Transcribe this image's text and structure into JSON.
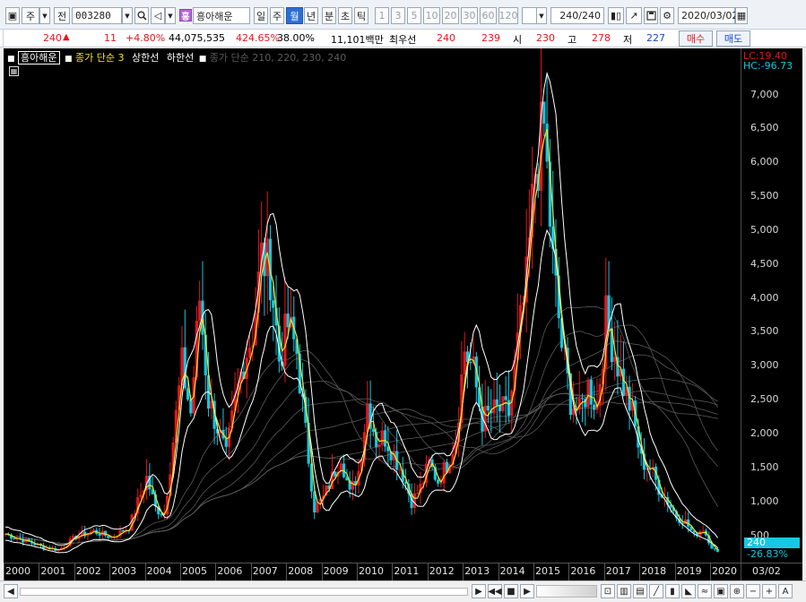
{
  "toolbar": {
    "market_label": "주",
    "prev_label": "전",
    "code": "003280",
    "stock_name": "흥아해운",
    "stock_badge": "흥",
    "periods": [
      "일",
      "주",
      "월",
      "년"
    ],
    "active_period": "월",
    "intraday": [
      "분",
      "초",
      "틱"
    ],
    "intervals": [
      "1",
      "3",
      "5",
      "10",
      "20",
      "30",
      "60",
      "120"
    ],
    "count": "240",
    "count_total": "/240",
    "date": "2020/03/02"
  },
  "quote": {
    "price": "240",
    "change": "11",
    "change_pct": "+4.80%",
    "volume": "44,075,535",
    "volume_ratio": "424.65%",
    "turnover": "38.00%",
    "amount": "11,101백만",
    "best_ask_label": "최우선",
    "best_ask": "240",
    "best_bid": "239",
    "open_label": "시",
    "open": "230",
    "high_label": "고",
    "high": "278",
    "low_label": "저",
    "low": "227",
    "buy_label": "매수",
    "sell_label": "매도"
  },
  "legend": {
    "name": "흥아해운",
    "ma": "종가 단순 3",
    "upper": "상한선",
    "lower": "하한선",
    "ma_multi": "종가 단순 210, 220, 230, 240"
  },
  "yaxis": {
    "lc": "LC:19.40",
    "hc": "HC:-96.73",
    "current": "240",
    "current_pct": "-26.83%"
  },
  "bottom": {
    "date_label": "03/02"
  },
  "colors": {
    "up": "#e5161e",
    "down": "#12c8e0",
    "ma": "#f2e12a",
    "band": "#ffffff",
    "thin": "#5a5a5a"
  },
  "chart_data": {
    "type": "candlestick",
    "x_ticks": [
      "2000",
      "2001",
      "2002",
      "2003",
      "2004",
      "2005",
      "2006",
      "2007",
      "2008",
      "2009",
      "2010",
      "2011",
      "2012",
      "2013",
      "2014",
      "2015",
      "2016",
      "2017",
      "2018",
      "2019",
      "2020"
    ],
    "y_ticks": [
      500,
      1000,
      1500,
      2000,
      2500,
      3000,
      3500,
      4000,
      4500,
      5000,
      5500,
      6000,
      6500,
      7000
    ],
    "ylim": [
      150,
      7550
    ],
    "close_series": [
      [
        "2000-01",
        520
      ],
      [
        "2000-07",
        430
      ],
      [
        "2001-01",
        340
      ],
      [
        "2001-07",
        280
      ],
      [
        "2002-01",
        480
      ],
      [
        "2002-07",
        560
      ],
      [
        "2003-01",
        470
      ],
      [
        "2003-07",
        620
      ],
      [
        "2004-01",
        1350
      ],
      [
        "2004-04",
        900
      ],
      [
        "2004-07",
        820
      ],
      [
        "2004-10",
        1900
      ],
      [
        "2005-01",
        3000
      ],
      [
        "2005-04",
        2300
      ],
      [
        "2005-07",
        4000
      ],
      [
        "2005-10",
        2500
      ],
      [
        "2006-01",
        2100
      ],
      [
        "2006-04",
        1650
      ],
      [
        "2006-07",
        2450
      ],
      [
        "2006-10",
        3100
      ],
      [
        "2007-01",
        3500
      ],
      [
        "2007-04",
        4600
      ],
      [
        "2007-07",
        4400
      ],
      [
        "2007-10",
        3100
      ],
      [
        "2008-01",
        3600
      ],
      [
        "2008-04",
        3200
      ],
      [
        "2008-07",
        2000
      ],
      [
        "2008-10",
        900
      ],
      [
        "2009-01",
        1050
      ],
      [
        "2009-04",
        1350
      ],
      [
        "2009-07",
        1700
      ],
      [
        "2009-10",
        1100
      ],
      [
        "2010-01",
        1450
      ],
      [
        "2010-04",
        2450
      ],
      [
        "2010-07",
        1900
      ],
      [
        "2010-10",
        1950
      ],
      [
        "2011-01",
        1700
      ],
      [
        "2011-04",
        1400
      ],
      [
        "2011-07",
        1000
      ],
      [
        "2011-10",
        1200
      ],
      [
        "2012-01",
        1550
      ],
      [
        "2012-04",
        1300
      ],
      [
        "2012-07",
        1550
      ],
      [
        "2012-10",
        1950
      ],
      [
        "2013-01",
        3250
      ],
      [
        "2013-04",
        2900
      ],
      [
        "2013-07",
        2200
      ],
      [
        "2013-10",
        2300
      ],
      [
        "2014-01",
        2350
      ],
      [
        "2014-04",
        2300
      ],
      [
        "2014-07",
        3300
      ],
      [
        "2014-10",
        4200
      ],
      [
        "2015-01",
        5900
      ],
      [
        "2015-04",
        6500
      ],
      [
        "2015-07",
        4500
      ],
      [
        "2015-10",
        3300
      ],
      [
        "2016-01",
        2500
      ],
      [
        "2016-04",
        2300
      ],
      [
        "2016-07",
        2700
      ],
      [
        "2016-10",
        2400
      ],
      [
        "2017-01",
        3700
      ],
      [
        "2017-04",
        3200
      ],
      [
        "2017-07",
        2700
      ],
      [
        "2017-10",
        2300
      ],
      [
        "2018-01",
        1600
      ],
      [
        "2018-04",
        1500
      ],
      [
        "2018-07",
        1200
      ],
      [
        "2018-10",
        1000
      ],
      [
        "2019-01",
        780
      ],
      [
        "2019-04",
        700
      ],
      [
        "2019-07",
        500
      ],
      [
        "2019-10",
        600
      ],
      [
        "2020-01",
        330
      ],
      [
        "2020-03",
        240
      ]
    ]
  }
}
